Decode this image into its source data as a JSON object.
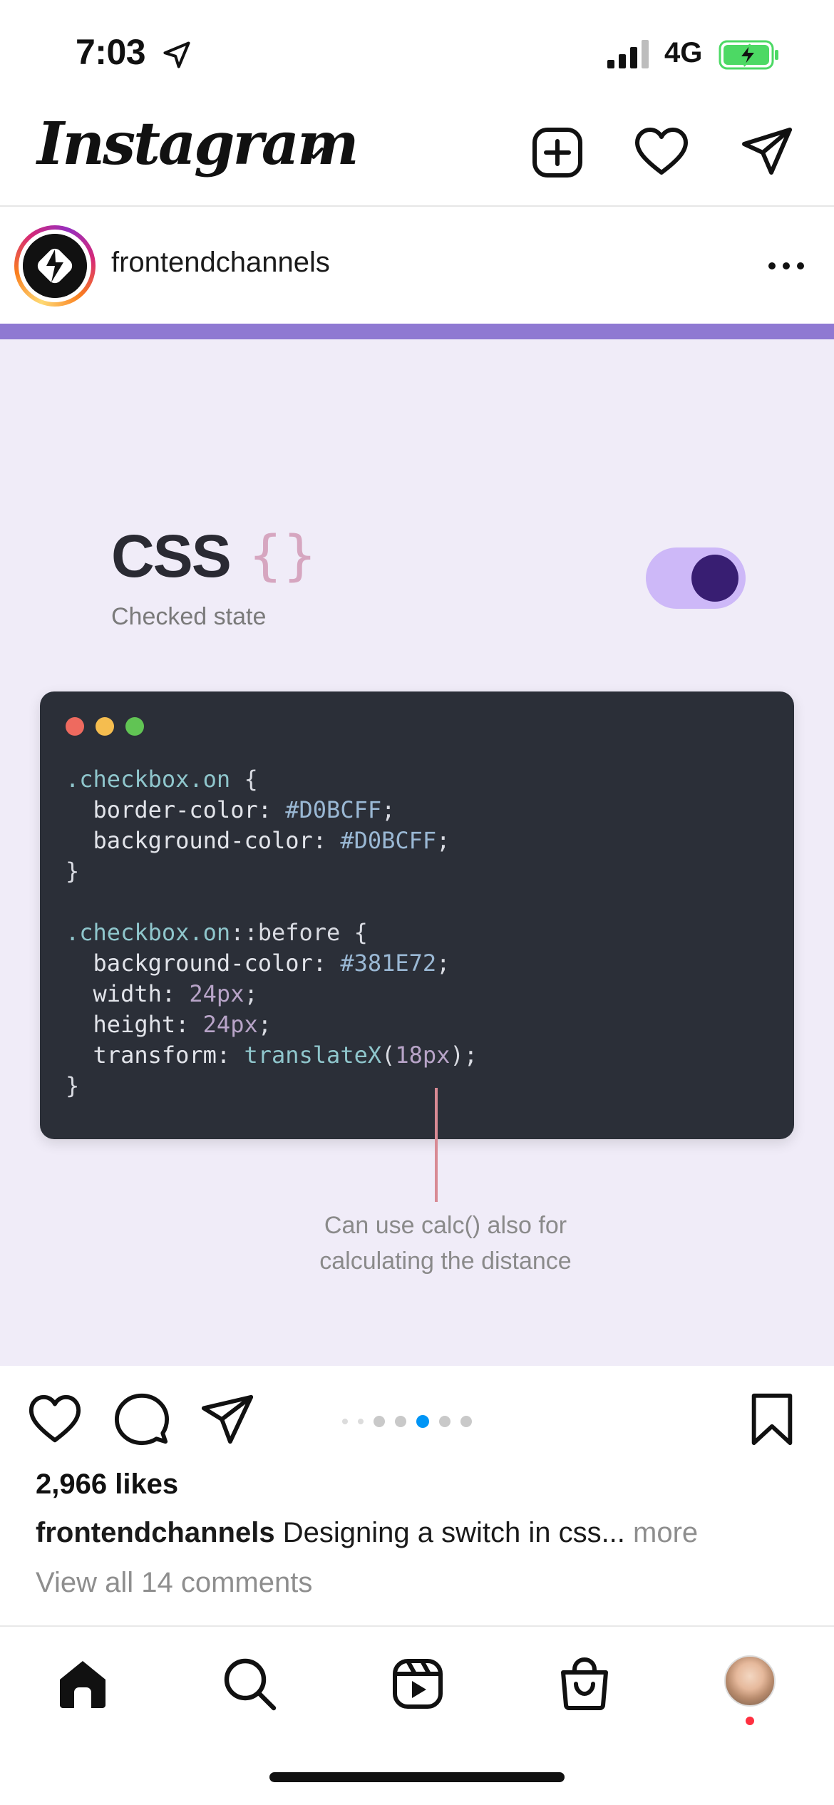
{
  "status_bar": {
    "time": "7:03",
    "network": "4G",
    "battery_color": "#4cd964"
  },
  "header": {
    "logo": "Instagram",
    "icons": [
      "chevron-down-icon",
      "create-post-icon",
      "heart-icon",
      "direct-message-icon"
    ]
  },
  "post": {
    "username": "frontendchannels",
    "media": {
      "title": "CSS",
      "braces": "{}",
      "subtitle": "Checked state",
      "toggle_state": "on",
      "code_lines": [
        [
          {
            "t": ".checkbox.on",
            "c": "c-sel"
          },
          {
            "t": " {",
            "c": ""
          }
        ],
        [
          {
            "t": "  border-color: ",
            "c": "c-prop"
          },
          {
            "t": "#D0BCFF",
            "c": "c-val"
          },
          {
            "t": ";",
            "c": ""
          }
        ],
        [
          {
            "t": "  background-color: ",
            "c": "c-prop"
          },
          {
            "t": "#D0BCFF",
            "c": "c-val"
          },
          {
            "t": ";",
            "c": ""
          }
        ],
        [
          {
            "t": "}",
            "c": ""
          }
        ],
        [
          {
            "t": "",
            "c": ""
          }
        ],
        [
          {
            "t": ".checkbox.on",
            "c": "c-sel"
          },
          {
            "t": "::before {",
            "c": ""
          }
        ],
        [
          {
            "t": "  background-color: ",
            "c": "c-prop"
          },
          {
            "t": "#381E72",
            "c": "c-val"
          },
          {
            "t": ";",
            "c": ""
          }
        ],
        [
          {
            "t": "  width: ",
            "c": "c-prop"
          },
          {
            "t": "24px",
            "c": "c-num"
          },
          {
            "t": ";",
            "c": ""
          }
        ],
        [
          {
            "t": "  height: ",
            "c": "c-prop"
          },
          {
            "t": "24px",
            "c": "c-num"
          },
          {
            "t": ";",
            "c": ""
          }
        ],
        [
          {
            "t": "  transform: ",
            "c": "c-prop"
          },
          {
            "t": "translateX",
            "c": "c-fn"
          },
          {
            "t": "(",
            "c": ""
          },
          {
            "t": "18px",
            "c": "c-num"
          },
          {
            "t": ");",
            "c": ""
          }
        ],
        [
          {
            "t": "}",
            "c": ""
          }
        ]
      ],
      "annotation_line1": "Can use calc() also for",
      "annotation_line2": "calculating the distance"
    },
    "carousel": {
      "count": 7,
      "active_index": 4
    },
    "likes": "2,966 likes",
    "caption_user": "frontendchannels",
    "caption_text": " Designing a switch in css...",
    "caption_more": " more",
    "view_comments": "View all 14 comments"
  },
  "bottom_nav": {
    "items": [
      "home-icon",
      "search-icon",
      "reels-icon",
      "shop-icon",
      "profile-avatar"
    ]
  }
}
